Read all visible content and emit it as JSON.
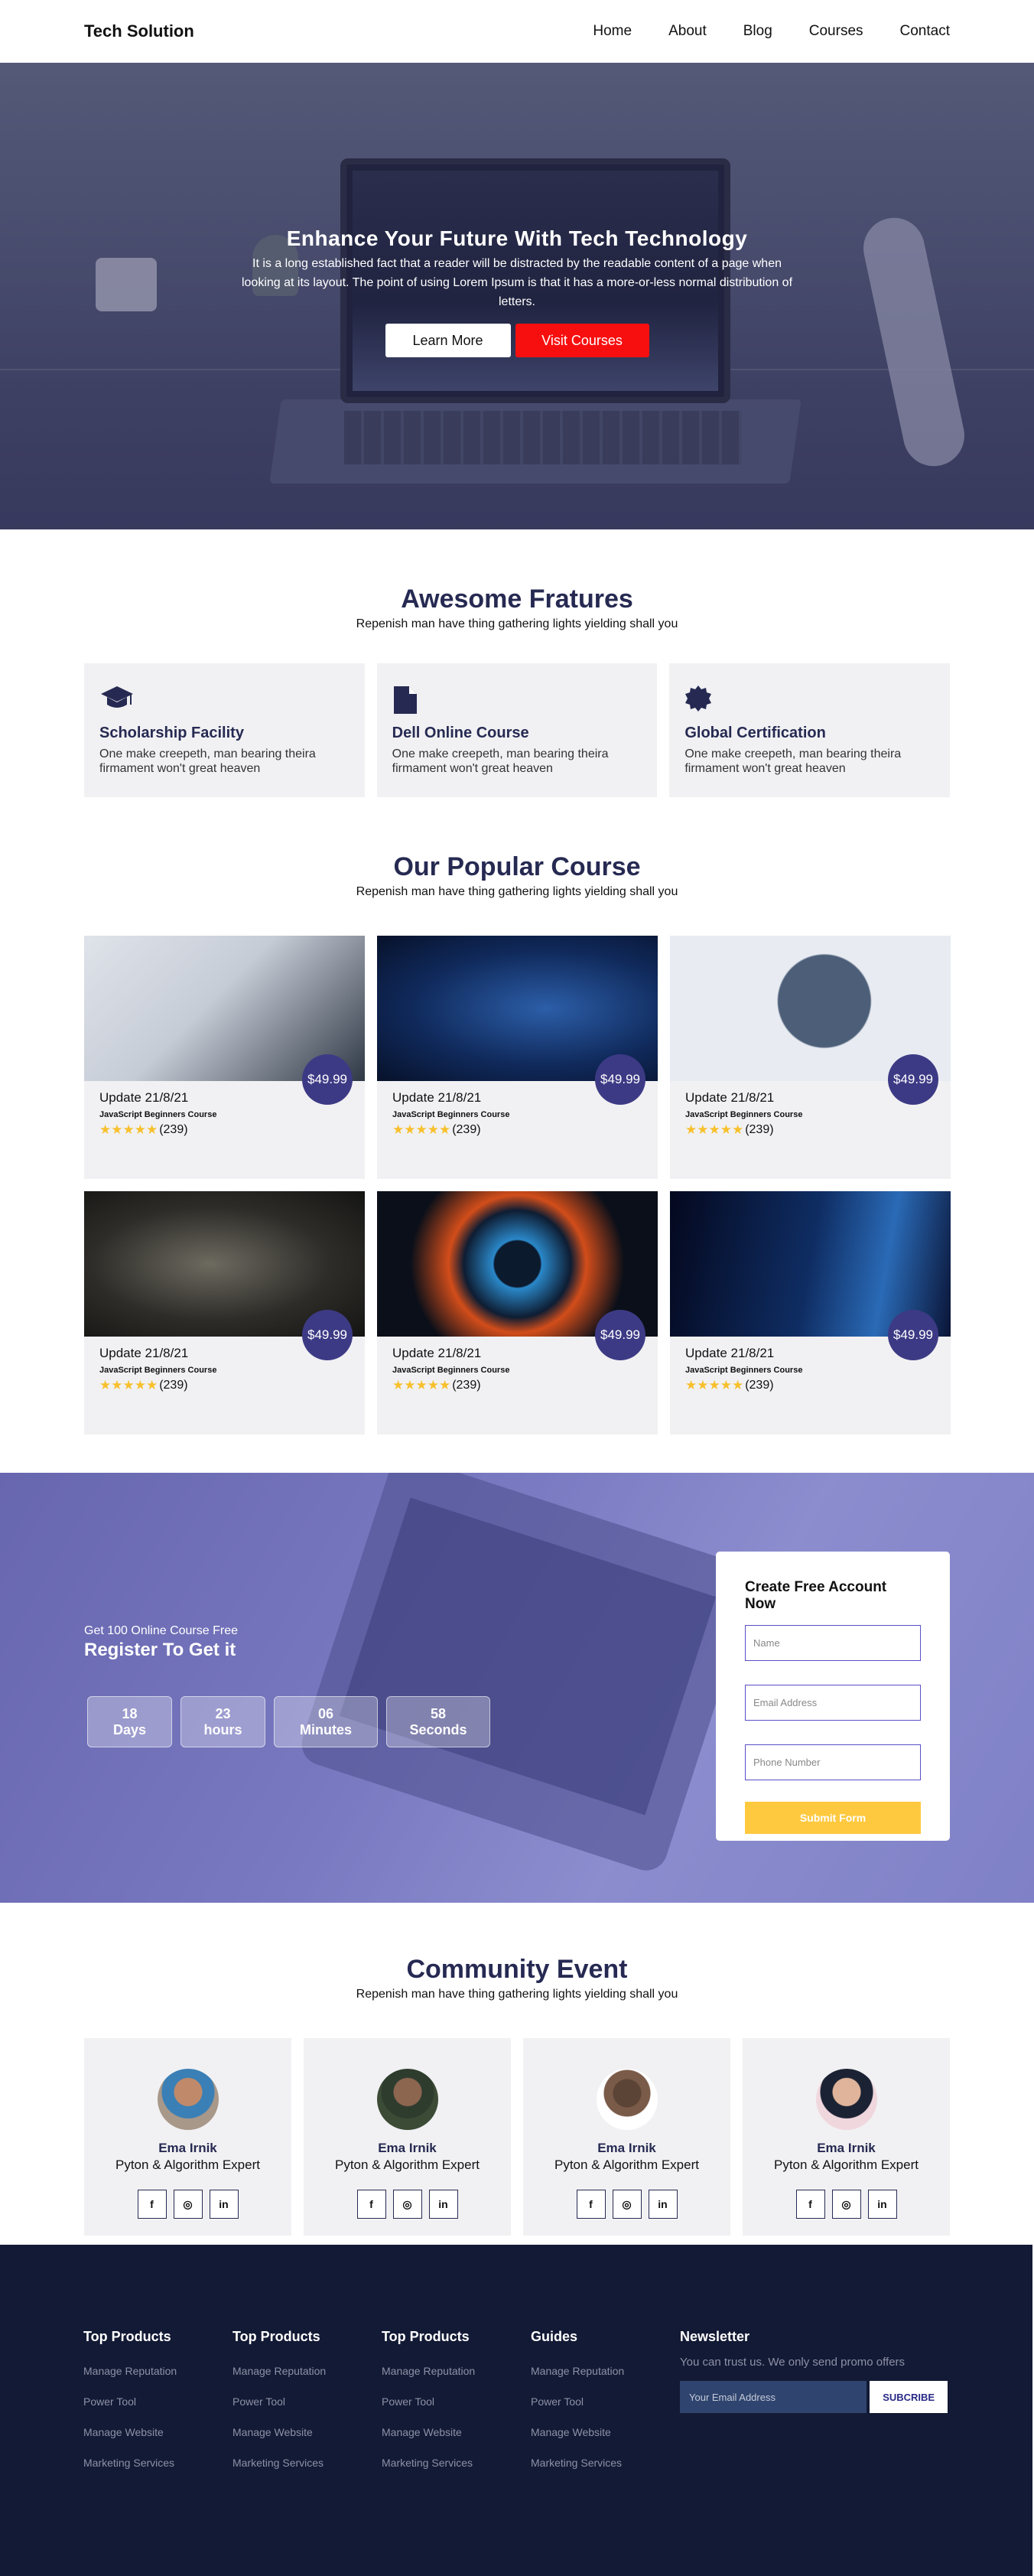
{
  "nav": {
    "brand": "Tech Solution",
    "links": [
      "Home",
      "About",
      "Blog",
      "Courses",
      "Contact"
    ]
  },
  "hero": {
    "title": "Enhance Your Future With Tech Technology",
    "text": "It is a long established fact that a reader will be distracted by the readable content of a page when looking at its layout. The point of using Lorem Ipsum is that it has a more-or-less normal distribution of letters.",
    "btn_learn": "Learn More",
    "btn_visit": "Visit Courses"
  },
  "features": {
    "title": "Awesome Fratures",
    "subtitle": "Repenish man have thing gathering lights yielding shall you",
    "items": [
      {
        "icon": "graduation-cap-icon",
        "title": "Scholarship Facility",
        "text": "One make creepeth, man bearing theira firmament won't great heaven"
      },
      {
        "icon": "file-icon",
        "title": "Dell Online Course",
        "text": "One make creepeth, man bearing theira firmament won't great heaven"
      },
      {
        "icon": "certificate-icon",
        "title": "Global Certification",
        "text": "One make creepeth, man bearing theira firmament won't great heaven"
      }
    ]
  },
  "courses": {
    "title": "Our Popular Course",
    "subtitle": "Repenish man have thing gathering lights yielding shall you",
    "items": [
      {
        "price": "$49.99",
        "date": "Update 21/8/21",
        "name": "JavaScript Beginners Course",
        "rating": 5,
        "count": "(239)"
      },
      {
        "price": "$49.99",
        "date": "Update 21/8/21",
        "name": "JavaScript Beginners Course",
        "rating": 5,
        "count": "(239)"
      },
      {
        "price": "$49.99",
        "date": "Update 21/8/21",
        "name": "JavaScript Beginners Course",
        "rating": 5,
        "count": "(239)"
      },
      {
        "price": "$49.99",
        "date": "Update 21/8/21",
        "name": "JavaScript Beginners Course",
        "rating": 5,
        "count": "(239)"
      },
      {
        "price": "$49.99",
        "date": "Update 21/8/21",
        "name": "JavaScript Beginners Course",
        "rating": 5,
        "count": "(239)"
      },
      {
        "price": "$49.99",
        "date": "Update 21/8/21",
        "name": "JavaScript Beginners Course",
        "rating": 5,
        "count": "(239)"
      }
    ]
  },
  "register": {
    "small": "Get 100 Online Course Free",
    "big": "Register To Get it",
    "countdown": [
      {
        "value": "18",
        "unit": "Days"
      },
      {
        "value": "23",
        "unit": "hours"
      },
      {
        "value": "06",
        "unit": "Minutes"
      },
      {
        "value": "58",
        "unit": "Seconds"
      }
    ],
    "form": {
      "title": "Create Free Account Now",
      "name_placeholder": "Name",
      "email_placeholder": "Email Address",
      "phone_placeholder": "Phone Number",
      "submit": "Submit Form"
    }
  },
  "event": {
    "title": "Community Event",
    "subtitle": "Repenish man have thing gathering lights yielding shall you",
    "members": [
      {
        "name": "Ema Irnik",
        "role": "Pyton & Algorithm Expert"
      },
      {
        "name": "Ema Irnik",
        "role": "Pyton & Algorithm Expert"
      },
      {
        "name": "Ema Irnik",
        "role": "Pyton & Algorithm Expert"
      },
      {
        "name": "Ema Irnik",
        "role": "Pyton & Algorithm Expert"
      }
    ],
    "social": {
      "facebook": "f",
      "instagram": "◎",
      "linkedin": "in"
    }
  },
  "footer": {
    "columns": [
      {
        "title": "Top Products",
        "links": [
          "Manage Reputation",
          "Power Tool",
          "Manage Website",
          "Marketing Services"
        ]
      },
      {
        "title": "Top Products",
        "links": [
          "Manage Reputation",
          "Power Tool",
          "Manage Website",
          "Marketing Services"
        ]
      },
      {
        "title": "Top Products",
        "links": [
          "Manage Reputation",
          "Power Tool",
          "Manage Website",
          "Marketing Services"
        ]
      },
      {
        "title": "Guides",
        "links": [
          "Manage Reputation",
          "Power Tool",
          "Manage Website",
          "Marketing Services"
        ]
      }
    ],
    "newsletter": {
      "title": "Newsletter",
      "text": "You can trust us. We only send promo offers",
      "placeholder": "Your Email Address",
      "button": "SUBCRIBE"
    }
  },
  "colors": {
    "primary_dark": "#262a52",
    "accent_red": "#f70f0f",
    "price_badge": "#3d3a85",
    "submit_yellow": "#ffc93f",
    "footer_bg": "#131a35",
    "star": "#f7c02c"
  }
}
